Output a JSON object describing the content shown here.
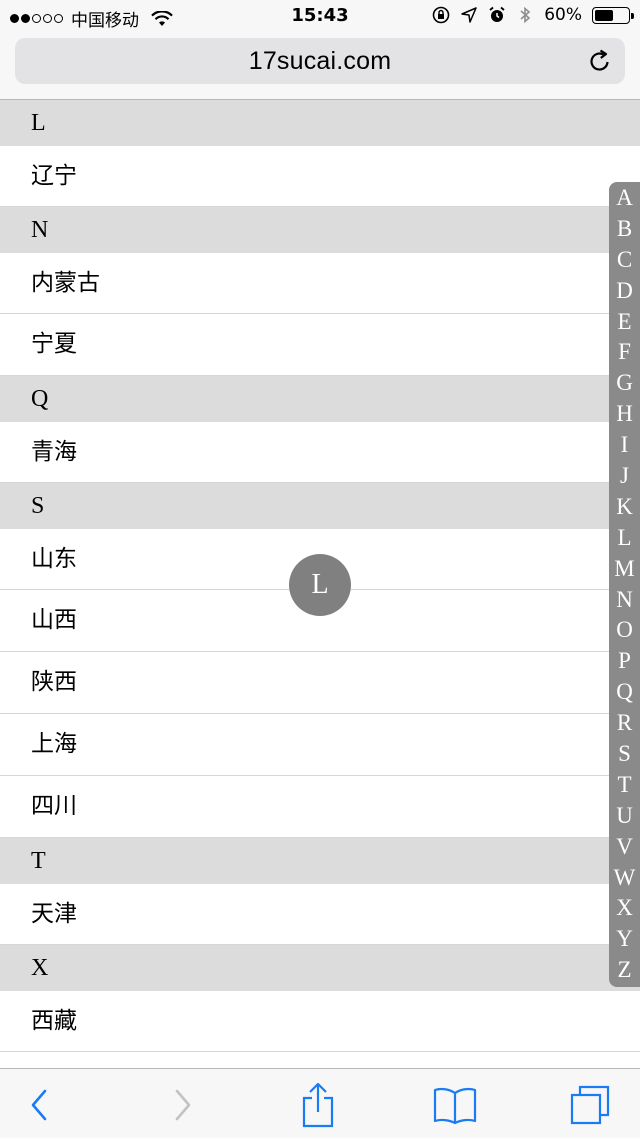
{
  "status_bar": {
    "carrier": "中国移动",
    "time": "15:43",
    "battery_percent": "60%",
    "battery_level": 0.6,
    "signal_dots_filled": 2,
    "signal_dots_total": 5,
    "icons": [
      "wifi-icon",
      "rotation-lock-icon",
      "location-icon",
      "alarm-icon",
      "bluetooth-icon",
      "battery-icon"
    ]
  },
  "address_bar": {
    "url": "17sucai.com",
    "reload_icon": "reload-icon"
  },
  "list": {
    "sections": [
      {
        "letter": "L",
        "items": [
          "辽宁"
        ]
      },
      {
        "letter": "N",
        "items": [
          "内蒙古",
          "宁夏"
        ]
      },
      {
        "letter": "Q",
        "items": [
          "青海"
        ]
      },
      {
        "letter": "S",
        "items": [
          "山东",
          "山西",
          "陕西",
          "上海",
          "四川"
        ]
      },
      {
        "letter": "T",
        "items": [
          "天津"
        ]
      },
      {
        "letter": "X",
        "items": [
          "西藏"
        ]
      }
    ]
  },
  "index_bubble": {
    "letter": "L"
  },
  "alphabet_index": [
    "A",
    "B",
    "C",
    "D",
    "E",
    "F",
    "G",
    "H",
    "I",
    "J",
    "K",
    "L",
    "M",
    "N",
    "O",
    "P",
    "Q",
    "R",
    "S",
    "T",
    "U",
    "V",
    "W",
    "X",
    "Y",
    "Z"
  ],
  "toolbar": {
    "buttons": [
      "back-icon",
      "forward-icon",
      "share-icon",
      "bookmarks-icon",
      "tabs-icon"
    ]
  },
  "colors": {
    "accent": "#1a7cf5",
    "disabled": "#c2c2c7",
    "section_bg": "#dcdcdc",
    "index_bg": "#8a8a8a",
    "bubble_bg": "#808080"
  }
}
